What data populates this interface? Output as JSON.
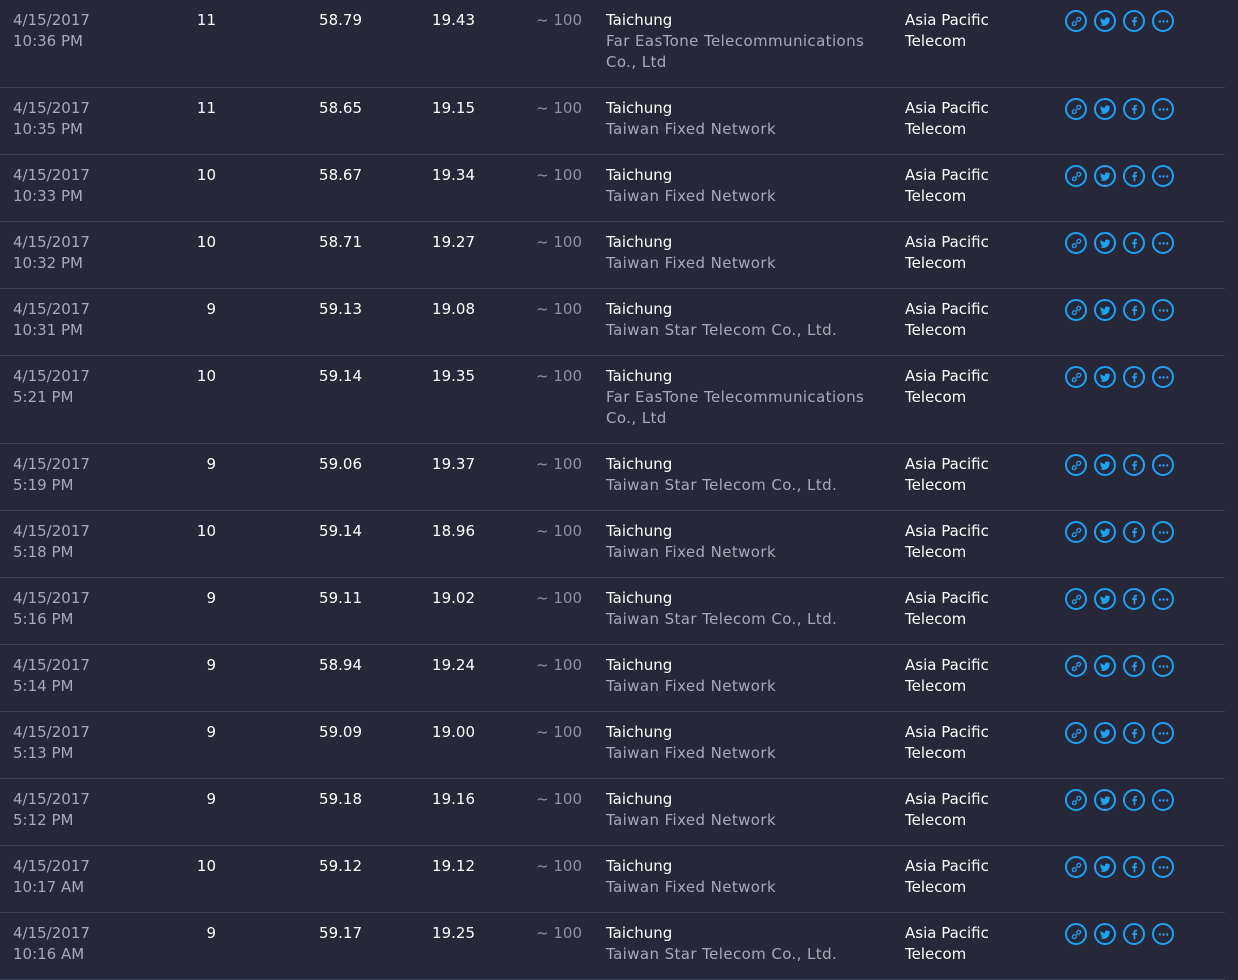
{
  "results": [
    {
      "date": "4/15/2017",
      "time": "10:36 PM",
      "ping": "11",
      "download": "58.79",
      "upload": "19.43",
      "packet": "~ 100",
      "city": "Taichung",
      "server": "Far EasTone Telecommunications Co., Ltd",
      "isp": "Asia Pacific Telecom"
    },
    {
      "date": "4/15/2017",
      "time": "10:35 PM",
      "ping": "11",
      "download": "58.65",
      "upload": "19.15",
      "packet": "~ 100",
      "city": "Taichung",
      "server": "Taiwan Fixed Network",
      "isp": "Asia Pacific Telecom"
    },
    {
      "date": "4/15/2017",
      "time": "10:33 PM",
      "ping": "10",
      "download": "58.67",
      "upload": "19.34",
      "packet": "~ 100",
      "city": "Taichung",
      "server": "Taiwan Fixed Network",
      "isp": "Asia Pacific Telecom"
    },
    {
      "date": "4/15/2017",
      "time": "10:32 PM",
      "ping": "10",
      "download": "58.71",
      "upload": "19.27",
      "packet": "~ 100",
      "city": "Taichung",
      "server": "Taiwan Fixed Network",
      "isp": "Asia Pacific Telecom"
    },
    {
      "date": "4/15/2017",
      "time": "10:31 PM",
      "ping": "9",
      "download": "59.13",
      "upload": "19.08",
      "packet": "~ 100",
      "city": "Taichung",
      "server": "Taiwan Star Telecom Co., Ltd.",
      "isp": "Asia Pacific Telecom"
    },
    {
      "date": "4/15/2017",
      "time": "5:21 PM",
      "ping": "10",
      "download": "59.14",
      "upload": "19.35",
      "packet": "~ 100",
      "city": "Taichung",
      "server": "Far EasTone Telecommunications Co., Ltd",
      "isp": "Asia Pacific Telecom"
    },
    {
      "date": "4/15/2017",
      "time": "5:19 PM",
      "ping": "9",
      "download": "59.06",
      "upload": "19.37",
      "packet": "~ 100",
      "city": "Taichung",
      "server": "Taiwan Star Telecom Co., Ltd.",
      "isp": "Asia Pacific Telecom"
    },
    {
      "date": "4/15/2017",
      "time": "5:18 PM",
      "ping": "10",
      "download": "59.14",
      "upload": "18.96",
      "packet": "~ 100",
      "city": "Taichung",
      "server": "Taiwan Fixed Network",
      "isp": "Asia Pacific Telecom"
    },
    {
      "date": "4/15/2017",
      "time": "5:16 PM",
      "ping": "9",
      "download": "59.11",
      "upload": "19.02",
      "packet": "~ 100",
      "city": "Taichung",
      "server": "Taiwan Star Telecom Co., Ltd.",
      "isp": "Asia Pacific Telecom"
    },
    {
      "date": "4/15/2017",
      "time": "5:14 PM",
      "ping": "9",
      "download": "58.94",
      "upload": "19.24",
      "packet": "~ 100",
      "city": "Taichung",
      "server": "Taiwan Fixed Network",
      "isp": "Asia Pacific Telecom"
    },
    {
      "date": "4/15/2017",
      "time": "5:13 PM",
      "ping": "9",
      "download": "59.09",
      "upload": "19.00",
      "packet": "~ 100",
      "city": "Taichung",
      "server": "Taiwan Fixed Network",
      "isp": "Asia Pacific Telecom"
    },
    {
      "date": "4/15/2017",
      "time": "5:12 PM",
      "ping": "9",
      "download": "59.18",
      "upload": "19.16",
      "packet": "~ 100",
      "city": "Taichung",
      "server": "Taiwan Fixed Network",
      "isp": "Asia Pacific Telecom"
    },
    {
      "date": "4/15/2017",
      "time": "10:17 AM",
      "ping": "10",
      "download": "59.12",
      "upload": "19.12",
      "packet": "~ 100",
      "city": "Taichung",
      "server": "Taiwan Fixed Network",
      "isp": "Asia Pacific Telecom"
    },
    {
      "date": "4/15/2017",
      "time": "10:16 AM",
      "ping": "9",
      "download": "59.17",
      "upload": "19.25",
      "packet": "~ 100",
      "city": "Taichung",
      "server": "Taiwan Star Telecom Co., Ltd.",
      "isp": "Asia Pacific Telecom"
    }
  ],
  "actions": [
    {
      "icon": "link-icon"
    },
    {
      "icon": "twitter-icon"
    },
    {
      "icon": "facebook-icon"
    },
    {
      "icon": "more-icon"
    }
  ],
  "colors": {
    "background": "#262839",
    "accent": "#1da1f2",
    "muted_text": "#a8a9b6",
    "divider": "#3d3f52"
  }
}
